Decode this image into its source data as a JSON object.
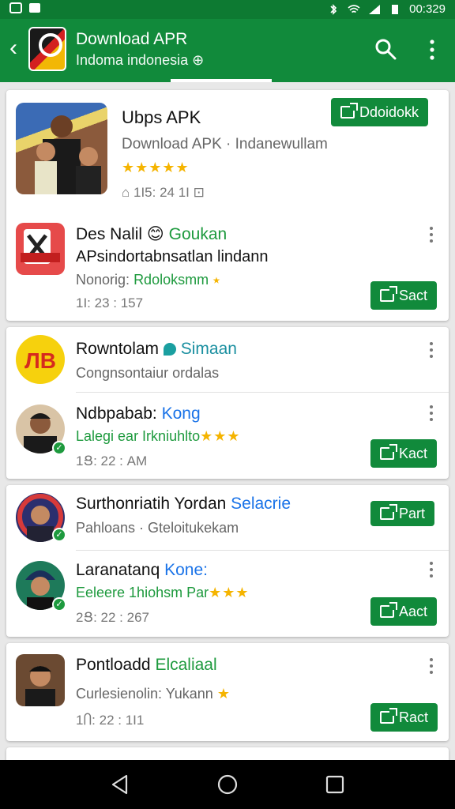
{
  "status": {
    "time": "00:329"
  },
  "appbar": {
    "title": "Download APR",
    "subtitle": "Indoma indonesia ⊕"
  },
  "featured": {
    "name": "Ubps APK",
    "description": "Download APK · Indanewullam",
    "rating_stars": "★★★★★",
    "meta": "⌂ 1І5: 24  1І  ⊡",
    "button": "Ddoidokk"
  },
  "rows": [
    {
      "name": "Des Nalil",
      "emoji": "😊",
      "tag": "Goukan",
      "line2": "APsindortabnsatlan lindann",
      "line3_label": "Nonorig:",
      "line3_green": "Rdoloksmm",
      "line3_stars": "⭑",
      "meta": "1І: 23 : 157",
      "button": "Sact"
    },
    {
      "name": "Rowntolam",
      "tag": "Simaan",
      "line2": "Congnsontaiur ordalas",
      "meta": ""
    },
    {
      "name": "Ndbpabab:",
      "tag": "Kong",
      "line2": "Lalegi ear Irkniuhlto",
      "stars": "★★★",
      "meta": "1Ց: 22 : AM",
      "button": "Kact"
    },
    {
      "name": "Surthonriatih Yordan",
      "tag": "Selacrie",
      "line2": "Pahloans · Gteloitukekam",
      "button": "Part"
    },
    {
      "name": "Laranatanq",
      "tag": "Kone:",
      "line2": "Eeleere 1hiohsm Par",
      "stars": "★★★",
      "meta": "2Ց: 22 : 267",
      "button": "Aact"
    },
    {
      "name": "Pontloadd",
      "tag": "Elcaliaal",
      "line2": "Curlesienolin: Yukann",
      "stars": "★",
      "meta": "1Ⴖ: 22 : 1І1",
      "button": "Ract"
    }
  ],
  "colors": {
    "brand_green": "#118a3b",
    "status_green": "#0d7a32",
    "accent_green": "#1e9a3e",
    "star_yellow": "#f5b400",
    "link_blue": "#1a73e8"
  }
}
